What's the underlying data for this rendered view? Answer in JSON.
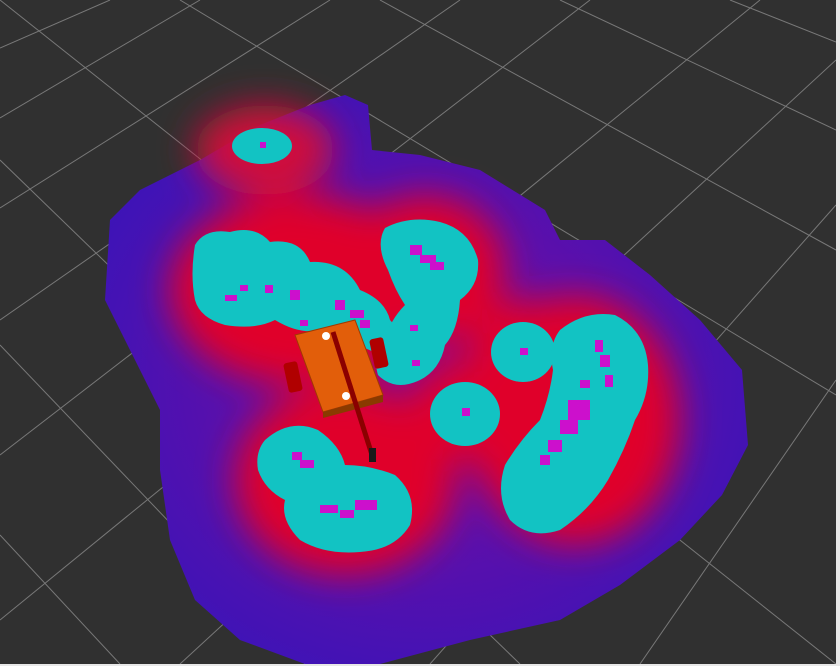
{
  "view": {
    "type": "3d-render",
    "background_color": "#303030",
    "grid_color": "#8a8a8a",
    "edge_color": "#e8e8e8"
  },
  "costmap": {
    "lethal_color": "#ff00ff",
    "inscribed_color": "#12c3c3",
    "inflation_colors": [
      "#ff0000",
      "#c00050",
      "#7a0aa0",
      "#3a10c0"
    ],
    "obstacle_cluster_count": 7
  },
  "robot": {
    "body_color": "#e25e0a",
    "wheel_color": "#b00000",
    "mast_color": "#8b0000",
    "caster_color": "#ffffff"
  }
}
